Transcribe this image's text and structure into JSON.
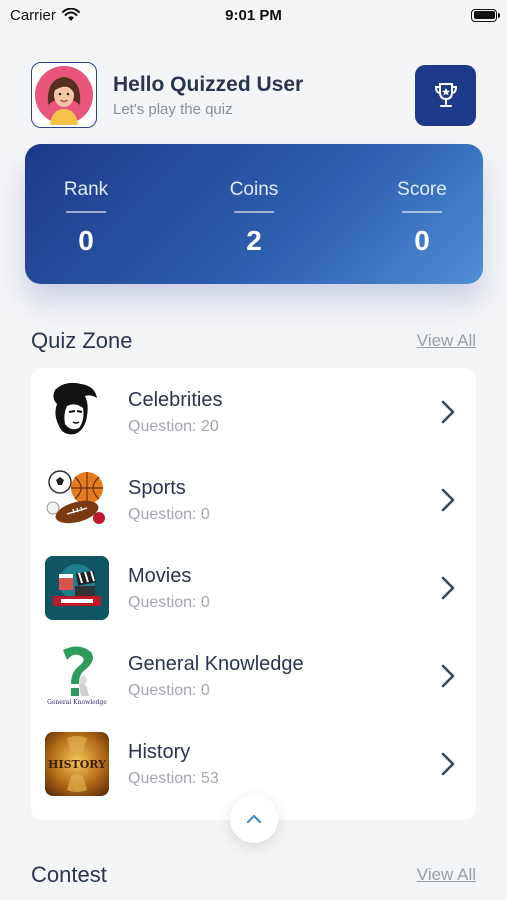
{
  "status_bar": {
    "carrier": "Carrier",
    "time": "9:01 PM"
  },
  "header": {
    "greeting": "Hello Quizzed User",
    "subtitle": "Let's play the quiz"
  },
  "stats": [
    {
      "label": "Rank",
      "value": "0"
    },
    {
      "label": "Coins",
      "value": "2"
    },
    {
      "label": "Score",
      "value": "0"
    }
  ],
  "quiz_zone": {
    "title": "Quiz Zone",
    "view_all": "View All",
    "items": [
      {
        "name": "Celebrities",
        "count": "Question: 20",
        "icon": "celebrity-portrait-icon"
      },
      {
        "name": "Sports",
        "count": "Question: 0",
        "icon": "sports-balls-icon"
      },
      {
        "name": "Movies",
        "count": "Question: 0",
        "icon": "movie-clapper-icon"
      },
      {
        "name": "General Knowledge",
        "count": "Question: 0",
        "icon": "general-knowledge-icon",
        "thumb_caption": "General Knowledge"
      },
      {
        "name": "History",
        "count": "Question: 53",
        "icon": "history-scroll-icon",
        "thumb_caption": "HISTORY"
      }
    ]
  },
  "contest": {
    "title": "Contest",
    "view_all": "View All"
  },
  "colors": {
    "primary": "#1e3a8a",
    "accent": "#4f8fd6",
    "background": "#f4f5f7"
  }
}
